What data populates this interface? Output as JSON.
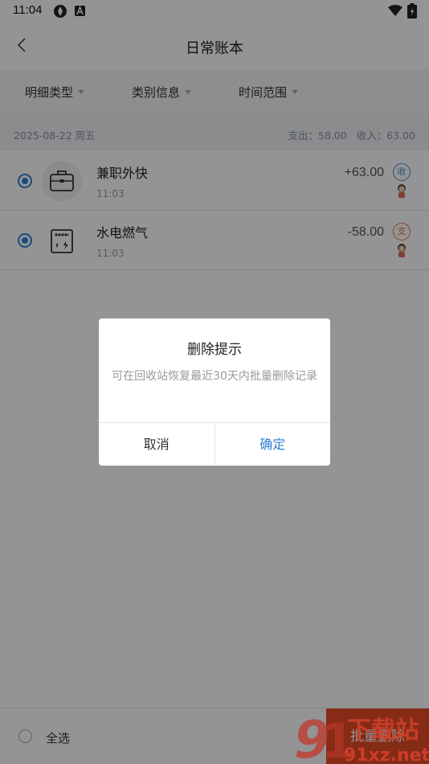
{
  "status_bar": {
    "time": "11:04"
  },
  "header": {
    "title": "日常账本"
  },
  "filters": [
    {
      "label": "明细类型"
    },
    {
      "label": "类别信息"
    },
    {
      "label": "时间范围"
    }
  ],
  "day_group": {
    "date": "2025-08-22 周五",
    "summary": "支出：58.00   收入：63.00"
  },
  "records": [
    {
      "name": "兼职外快",
      "time": "11:03",
      "amount": "+63.00",
      "badge": "收",
      "selected": true,
      "icon": "briefcase-icon"
    },
    {
      "name": "水电燃气",
      "time": "11:03",
      "amount": "-58.00",
      "badge": "支",
      "selected": true,
      "icon": "utility-meter-icon"
    }
  ],
  "bottom_bar": {
    "select_all": "全选",
    "batch_delete": "批量删除"
  },
  "dialog": {
    "title": "删除提示",
    "message": "可在回收站恢复最近30天内批量删除记录",
    "cancel": "取消",
    "confirm": "确定"
  },
  "watermark": {
    "text": "91xz.net",
    "logo_text": "下载站"
  },
  "colors": {
    "accent": "#2f80d6",
    "danger": "#e64a26",
    "income": "#4a90d9",
    "expense": "#e0785a"
  }
}
